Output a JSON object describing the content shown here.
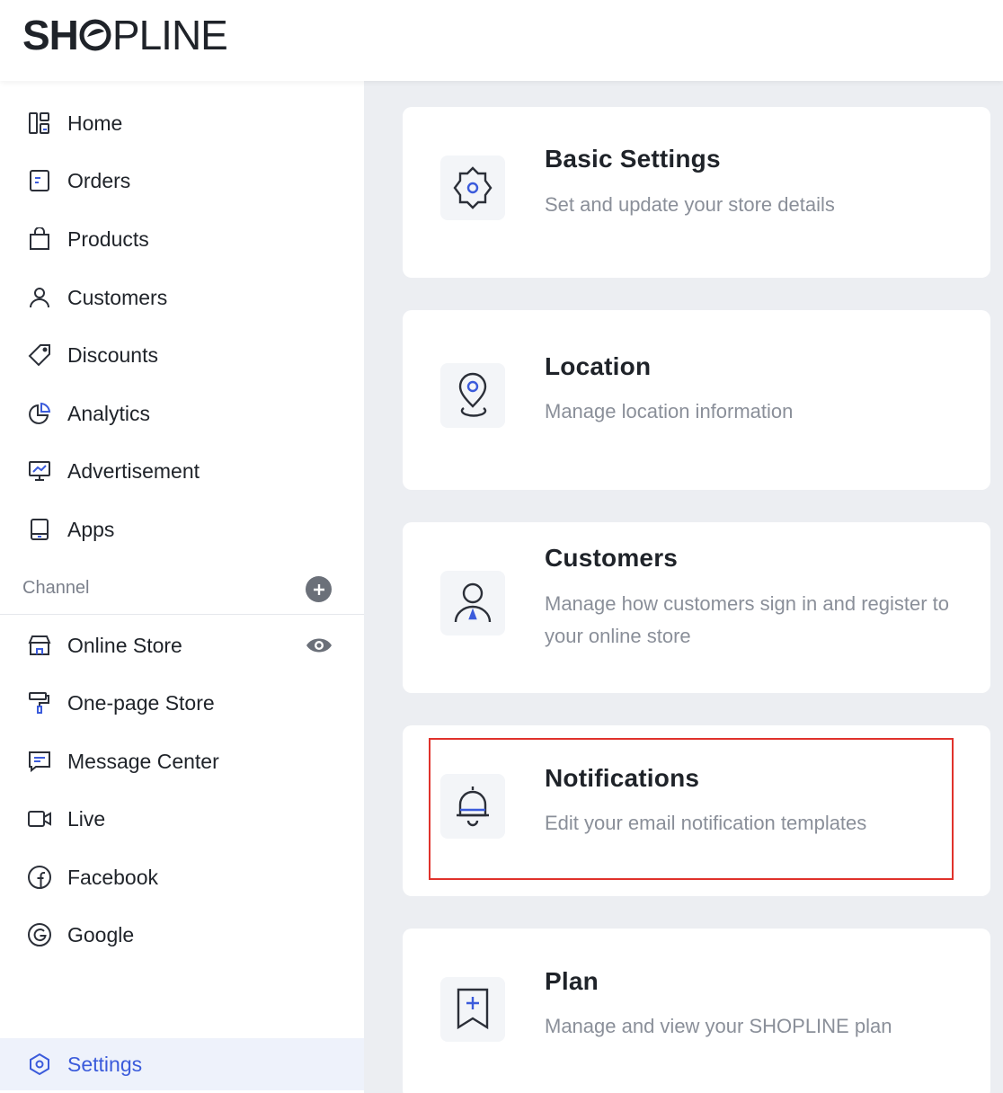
{
  "brand": {
    "logo_left": "SH",
    "logo_right": "PLINE"
  },
  "sidebar": {
    "items": [
      {
        "label": "Home",
        "icon": "dashboard-icon"
      },
      {
        "label": "Orders",
        "icon": "orders-icon"
      },
      {
        "label": "Products",
        "icon": "bag-icon"
      },
      {
        "label": "Customers",
        "icon": "person-icon"
      },
      {
        "label": "Discounts",
        "icon": "tag-icon"
      },
      {
        "label": "Analytics",
        "icon": "pie-chart-icon"
      },
      {
        "label": "Advertisement",
        "icon": "monitor-chart-icon"
      },
      {
        "label": "Apps",
        "icon": "tablet-icon"
      }
    ],
    "channel_label": "Channel",
    "channels": [
      {
        "label": "Online Store",
        "icon": "storefront-icon"
      },
      {
        "label": "One-page Store",
        "icon": "paint-roller-icon"
      },
      {
        "label": "Message Center",
        "icon": "message-icon"
      },
      {
        "label": "Live",
        "icon": "video-camera-icon"
      },
      {
        "label": "Facebook",
        "icon": "facebook-icon"
      },
      {
        "label": "Google",
        "icon": "google-icon"
      }
    ],
    "settings_label": "Settings"
  },
  "cards": [
    {
      "title": "Basic Settings",
      "desc": "Set and update your store details",
      "icon": "gear-icon"
    },
    {
      "title": "Location",
      "desc": "Manage location information",
      "icon": "location-pin-icon"
    },
    {
      "title": "Customers",
      "desc": "Manage how customers sign in and register to your online store",
      "icon": "customer-icon"
    },
    {
      "title": "Notifications",
      "desc": "Edit your email notification templates",
      "icon": "bell-icon"
    },
    {
      "title": "Plan",
      "desc": "Manage and view your SHOPLINE plan",
      "icon": "bookmark-plus-icon"
    }
  ],
  "colors": {
    "accent": "#3b5bdb",
    "highlight": "#e0322c",
    "content_bg": "#eceef2"
  }
}
